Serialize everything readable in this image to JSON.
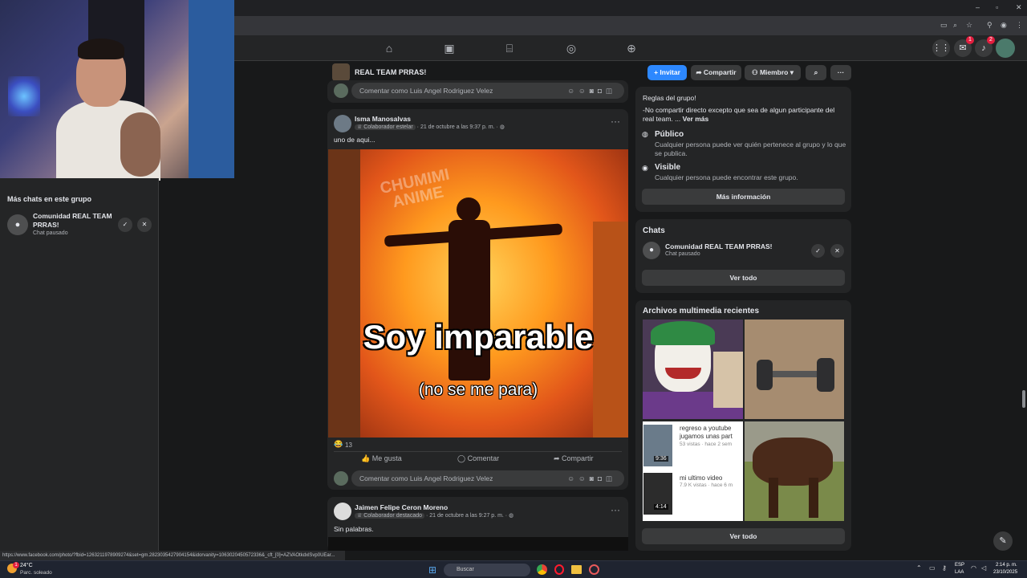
{
  "browser": {
    "status_url": "https://www.facebook.com/photo/?fbid=1263211978909274&set=gm.2823035427904154&idorvanity=1063020450572336&_cft_[0]=AZVAOtkdxlSvp0UEar..."
  },
  "nav": {
    "messenger_badge": "1",
    "notifications_badge": "2"
  },
  "left_panel": {
    "title": "Más chats en este grupo",
    "chat": {
      "name": "Comunidad REAL TEAM PRRAS!",
      "status": "Chat pausado"
    }
  },
  "group": {
    "name": "REAL TEAM PRRAS!",
    "invite_label": "Invitar",
    "share_label": "Compartir",
    "member_label": "Miembro"
  },
  "feed": {
    "comment_placeholder": "Comentar como Luis Angel Rodriguez Velez",
    "post1": {
      "author": "Isma Manosalvas",
      "role": "Colaborador estelar",
      "time": "· 21 de octubre a las 9:37 p. m. ·",
      "text": "uno de aqui...",
      "image_watermark": "CHUMIMI ANIME",
      "image_caption": "Soy imparable",
      "image_subcaption": "(no se me para)",
      "reaction_count": "13",
      "like_label": "Me gusta",
      "comment_label": "Comentar",
      "share_label": "Compartir"
    },
    "post2": {
      "author": "Jaimen Felipe Ceron Moreno",
      "role": "Colaborador destacado",
      "time": "· 21 de octubre a las 9:27 p. m. ·",
      "text": "Sin palabras."
    }
  },
  "sidebar": {
    "rules_title": "Reglas del grupo!",
    "rules_text": "-No compartir directo excepto que sea de algun participante del real team. ...",
    "see_more": "Ver más",
    "public_title": "Público",
    "public_desc": "Cualquier persona puede ver quién pertenece al grupo y lo que se publica.",
    "visible_title": "Visible",
    "visible_desc": "Cualquier persona puede encontrar este grupo.",
    "more_info_label": "Más información",
    "chats_title": "Chats",
    "chat_name": "Comunidad REAL TEAM PRRAS!",
    "chat_status": "Chat pausado",
    "see_all_label": "Ver todo",
    "media_title": "Archivos multimedia recientes",
    "media": {
      "tile3_title": "regreso a youtube jugamos unas part",
      "tile3_views": "53 vistas · hace 2 sem",
      "tile3_dur": "9:36",
      "tile3_title2": "mi ultimo video",
      "tile3_views2": "7.9 K vistas · hace 6 m",
      "tile3_dur2": "4:14"
    },
    "media_see_all": "Ver todo"
  },
  "taskbar": {
    "temp": "24°C",
    "weather": "Parc. soleado",
    "search_placeholder": "Buscar",
    "lang1": "ESP",
    "lang2": "LAA",
    "time": "2:14 p. m.",
    "date": "23/10/2025",
    "weather_badge": "1"
  }
}
